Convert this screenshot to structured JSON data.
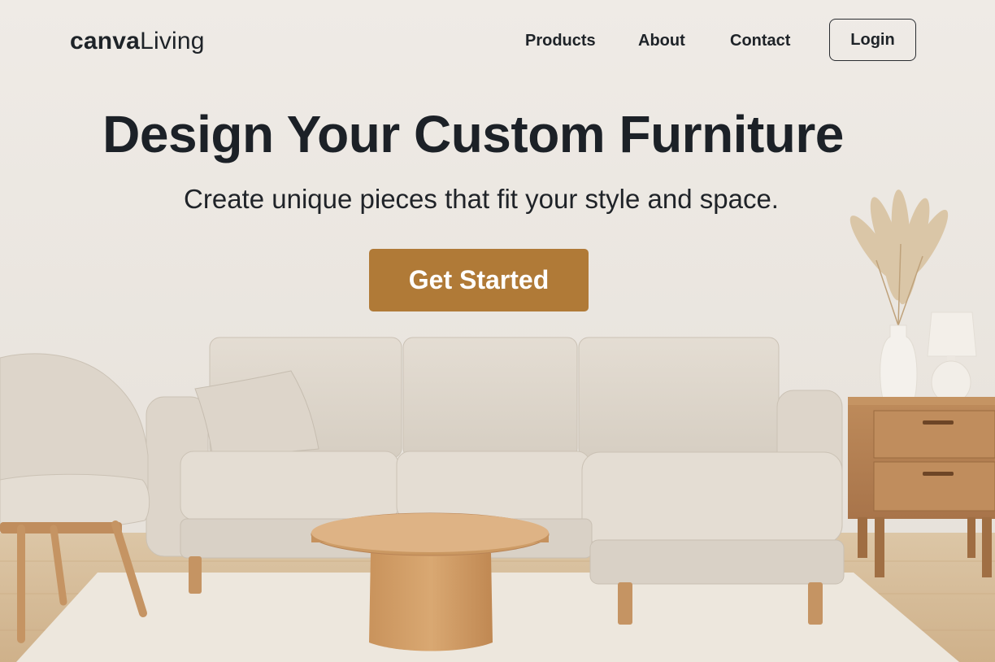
{
  "brand": {
    "logo_bold": "canva",
    "logo_light": "Living"
  },
  "nav": {
    "items": [
      {
        "label": "Products"
      },
      {
        "label": "About"
      },
      {
        "label": "Contact"
      }
    ],
    "login_label": "Login"
  },
  "hero": {
    "title": "Design Your Custom Furniture",
    "subtitle": "Create unique pieces that fit your style and space.",
    "cta_label": "Get Started"
  },
  "colors": {
    "accent": "#b07a37",
    "text": "#1c2127",
    "wall": "#ece8e2",
    "floor": "#d8c3a5"
  },
  "scene": {
    "objects": [
      "armchair",
      "sectional-sofa",
      "throw-pillow",
      "coffee-table",
      "nightstand",
      "table-lamp",
      "vase",
      "pampas-grass",
      "rug"
    ]
  }
}
